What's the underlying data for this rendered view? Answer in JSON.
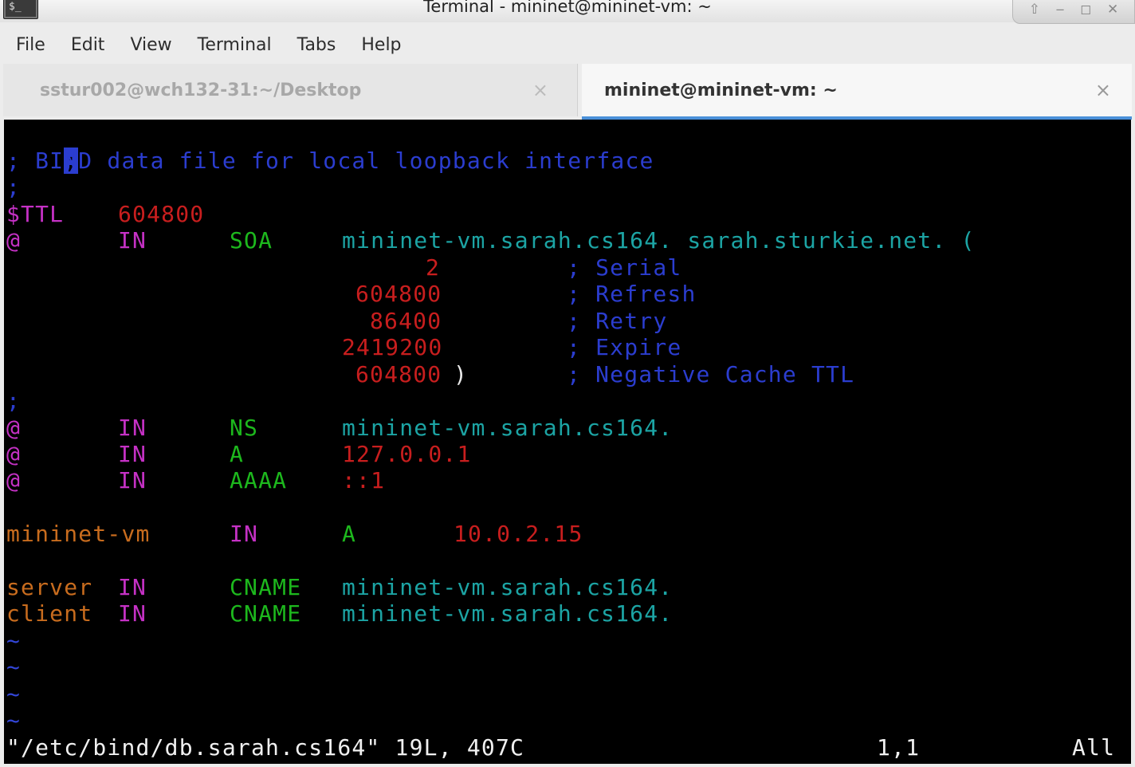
{
  "window": {
    "title": "Terminal - mininet@mininet-vm: ~",
    "app_icon_glyph": "$_",
    "buttons": {
      "up": "⇧",
      "minimize": "‒",
      "maximize": "◻",
      "close": "✕"
    }
  },
  "menu": [
    "File",
    "Edit",
    "View",
    "Terminal",
    "Tabs",
    "Help"
  ],
  "tabs": [
    {
      "label": "sstur002@wch132-31:~/Desktop",
      "active": false,
      "close": "×"
    },
    {
      "label": "mininet@mininet-vm: ~",
      "active": true,
      "close": "×"
    }
  ],
  "colors": {
    "comment": "#2b3dcf",
    "directive": "#c531c5",
    "number": "#c81e1e",
    "type": "#1db81d",
    "domain": "#1ca4a4",
    "host": "#c86c1e",
    "tilde": "#3346d8"
  },
  "editor": {
    "cursor_char": ";",
    "comment_line": "; BIND data file for local loopback interface",
    "semicolon": ";",
    "ttl": {
      "key": "$TTL",
      "value": "604800"
    },
    "soa": {
      "origin": "@",
      "class": "IN",
      "type": "SOA",
      "target": "mininet-vm.sarah.cs164. sarah.sturkie.net. (",
      "serial": "2",
      "serial_comment": "; Serial",
      "refresh": "604800",
      "refresh_comment": "; Refresh",
      "retry": "86400",
      "retry_comment": "; Retry",
      "expire": "2419200",
      "expire_comment": "; Expire",
      "negative": "604800",
      "close_paren": ")",
      "negative_comment": "; Negative Cache TTL"
    },
    "records": [
      {
        "name": "@",
        "class": "IN",
        "type": "NS",
        "value": "mininet-vm.sarah.cs164."
      },
      {
        "name": "@",
        "class": "IN",
        "type": "A",
        "value": "127.0.0.1"
      },
      {
        "name": "@",
        "class": "IN",
        "type": "AAAA",
        "value": "::1"
      }
    ],
    "host_record": {
      "name": "mininet-vm",
      "class": "IN",
      "type": "A",
      "value": "10.0.2.15"
    },
    "cnames": [
      {
        "name": "server",
        "class": "IN",
        "type": "CNAME",
        "value": "mininet-vm.sarah.cs164."
      },
      {
        "name": "client",
        "class": "IN",
        "type": "CNAME",
        "value": "mininet-vm.sarah.cs164."
      }
    ],
    "tilde": "~",
    "status": {
      "file": "\"/etc/bind/db.sarah.cs164\" 19L, 407C",
      "position": "1,1",
      "scroll": "All"
    }
  }
}
